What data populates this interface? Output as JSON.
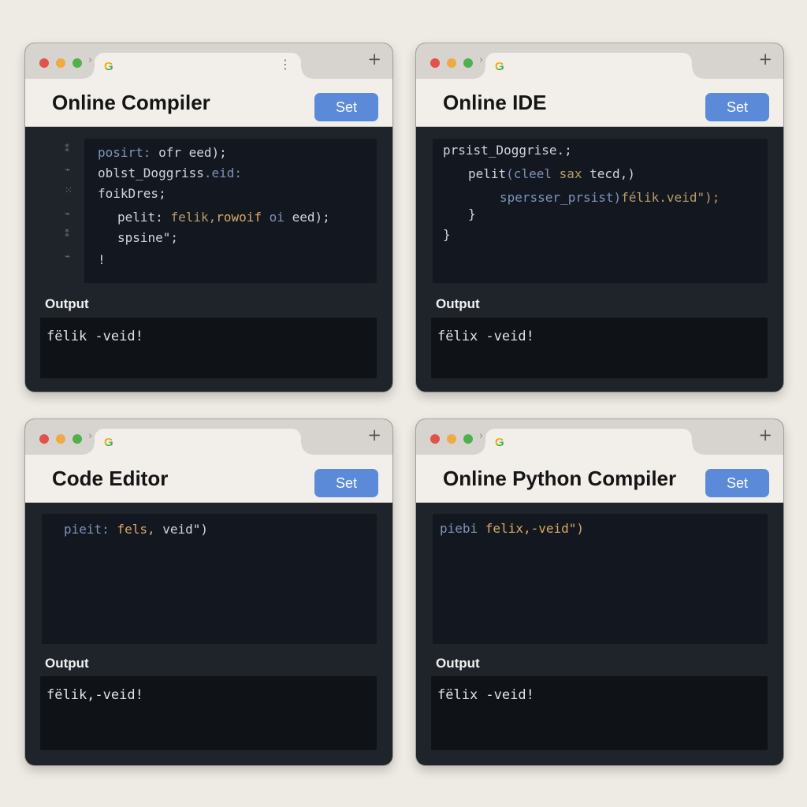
{
  "windows": [
    {
      "title": "Online Compiler",
      "button": "Set",
      "output_label": "Output",
      "output": "fëlik -veid!",
      "code": [
        {
          "parts": [
            [
              "kw",
              "posirt: "
            ],
            [
              "",
              "ofr eed);"
            ]
          ]
        },
        {
          "parts": [
            [
              "",
              "oblst_Doggriss"
            ],
            [
              "kw",
              ".eid:"
            ]
          ]
        },
        {
          "parts": [
            [
              "",
              "foikDres;"
            ]
          ]
        },
        {
          "parts": [
            [
              "",
              "pelit: "
            ],
            [
              "fn",
              "felik,"
            ],
            [
              "st",
              "rowoif"
            ],
            [
              "kw",
              " oi "
            ],
            [
              "",
              "eed);"
            ]
          ]
        },
        {
          "parts": [
            [
              "",
              "spsine\";"
            ]
          ]
        },
        {
          "parts": [
            [
              "",
              "!"
            ]
          ]
        }
      ]
    },
    {
      "title": "Online IDE",
      "button": "Set",
      "output_label": "Output",
      "output": "fëlix -veid!",
      "code": [
        {
          "parts": [
            [
              "",
              "prsist_Doggrise.;"
            ]
          ]
        },
        {
          "parts": [
            [
              "",
              "pelit"
            ],
            [
              "kw",
              "(cleel "
            ],
            [
              "fn",
              "sax "
            ],
            [
              "",
              "tecd,)"
            ]
          ]
        },
        {
          "parts": [
            [
              "kw",
              "spersser_prsist)"
            ],
            [
              "fn",
              "félik.veid\");"
            ]
          ]
        },
        {
          "parts": [
            [
              "",
              "}"
            ]
          ]
        },
        {
          "parts": [
            [
              "",
              "}"
            ]
          ]
        }
      ]
    },
    {
      "title": "Code Editor",
      "button": "Set",
      "output_label": "Output",
      "output": "fëlik,-veid!",
      "code": [
        {
          "parts": [
            [
              "kw",
              "pieit:"
            ],
            [
              "st",
              " fels, "
            ],
            [
              "",
              "veid\")"
            ]
          ]
        }
      ]
    },
    {
      "title": "Online Python Compiler",
      "button": "Set",
      "output_label": "Output",
      "output": "fëlix -veid!",
      "code": [
        {
          "parts": [
            [
              "kw",
              "piebi "
            ],
            [
              "st",
              "felix,-veid\")"
            ]
          ]
        }
      ]
    }
  ],
  "gutter_marks": [
    "⁑",
    "⌁",
    "⁙",
    "⌁",
    "⁑",
    "⌁"
  ],
  "tab": {
    "logo": "G",
    "new_tab": "+",
    "menu": "⋮",
    "nav": "›"
  }
}
